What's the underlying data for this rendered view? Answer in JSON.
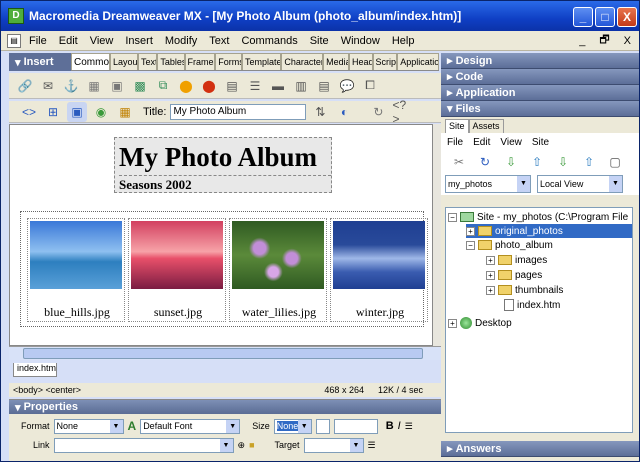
{
  "window": {
    "title": "Macromedia Dreamweaver MX - [My Photo Album (photo_album/index.htm)]",
    "app_icon": "dreamweaver-icon",
    "controls": [
      "_",
      "□",
      "X"
    ]
  },
  "menu": {
    "items": [
      "File",
      "Edit",
      "View",
      "Insert",
      "Modify",
      "Text",
      "Commands",
      "Site",
      "Window",
      "Help"
    ],
    "doc_controls": [
      "_",
      "🗗",
      "X"
    ]
  },
  "insert_bar": {
    "title": "Insert",
    "tabs": [
      "Common",
      "Layout",
      "Text",
      "Tables",
      "Frames",
      "Forms",
      "Templates",
      "Characters",
      "Media",
      "Head",
      "Script",
      "Application"
    ],
    "active_tab": "Common"
  },
  "document_toolbar": {
    "title_label": "Title:",
    "title_value": "My Photo Album"
  },
  "page": {
    "heading": "My Photo Album",
    "subheading": "Seasons 2002",
    "photos": [
      {
        "caption": "blue_hills.jpg",
        "colors": [
          "#3a78d8",
          "#8fc0f0",
          "#2d7fbf"
        ]
      },
      {
        "caption": "sunset.jpg",
        "colors": [
          "#e8506a",
          "#f7a3a8",
          "#7a1c42"
        ]
      },
      {
        "caption": "water_lilies.jpg",
        "colors": [
          "#2f5a22",
          "#c28ed8",
          "#5b8a3a"
        ]
      },
      {
        "caption": "winter.jpg",
        "colors": [
          "#1f3f92",
          "#9fb8e8",
          "#294a9a"
        ]
      }
    ]
  },
  "doc_tab": "index.htm",
  "status": {
    "tags": "<body> <center>",
    "size": "468 x 264",
    "download": "12K / 4 sec"
  },
  "properties": {
    "title": "Properties",
    "format_label": "Format",
    "format_value": "None",
    "font_value": "Default Font",
    "size_label": "Size",
    "size_value": "None",
    "link_label": "Link",
    "target_label": "Target"
  },
  "right_panels": {
    "design": "Design",
    "code": "Code",
    "application": "Application",
    "files": "Files",
    "answers": "Answers"
  },
  "files_panel": {
    "tabs": [
      "Site",
      "Assets"
    ],
    "menu": [
      "File",
      "Edit",
      "View",
      "Site"
    ],
    "site_select": "my_photos",
    "view_select": "Local View",
    "tree": {
      "root": "Site - my_photos (C:\\Program File",
      "original_photos": "original_photos",
      "photo_album": "photo_album",
      "images": "images",
      "pages": "pages",
      "thumbnails": "thumbnails",
      "index": "index.htm",
      "desktop": "Desktop"
    }
  }
}
